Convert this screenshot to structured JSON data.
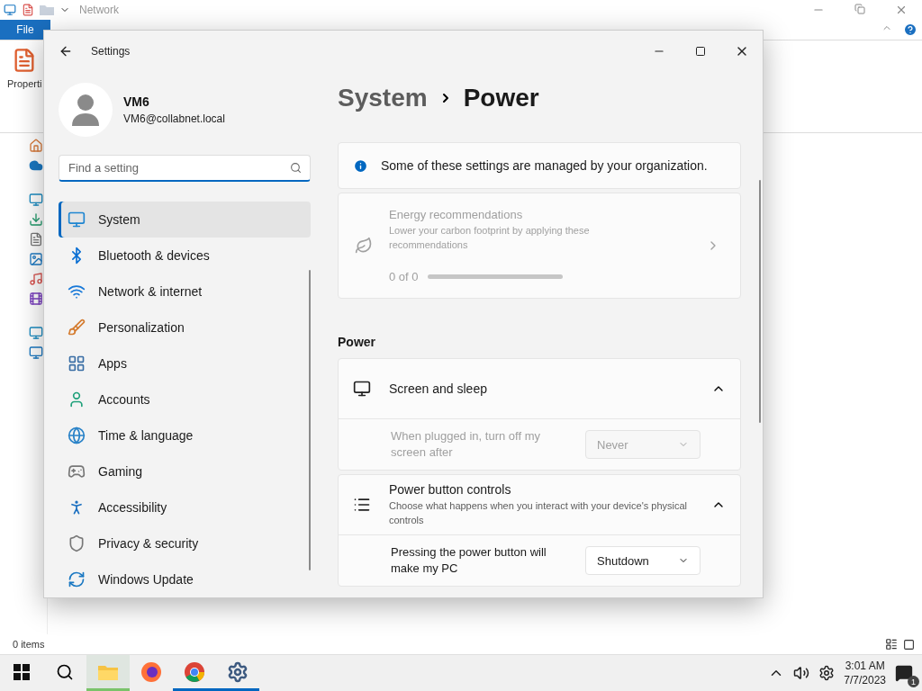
{
  "explorer": {
    "title": "Network",
    "ribbon_tabs": [
      {
        "label": "File",
        "selected": true
      }
    ],
    "ribbon_button": "Properti",
    "status": "0 items"
  },
  "settings": {
    "title": "Settings",
    "user": {
      "name": "VM6",
      "email": "VM6@collabnet.local"
    },
    "search": {
      "placeholder": "Find a setting",
      "focused": true
    },
    "nav": [
      {
        "label": "System",
        "selected": true
      },
      {
        "label": "Bluetooth & devices",
        "selected": false
      },
      {
        "label": "Network & internet",
        "selected": false
      },
      {
        "label": "Personalization",
        "selected": false
      },
      {
        "label": "Apps",
        "selected": false
      },
      {
        "label": "Accounts",
        "selected": false
      },
      {
        "label": "Time & language",
        "selected": false
      },
      {
        "label": "Gaming",
        "selected": false
      },
      {
        "label": "Accessibility",
        "selected": false
      },
      {
        "label": "Privacy & security",
        "selected": false
      },
      {
        "label": "Windows Update",
        "selected": false
      }
    ],
    "breadcrumb": [
      "System",
      "Power"
    ],
    "notice": "Some of these settings are managed by your organization.",
    "energy": {
      "title": "Energy recommendations",
      "description": "Lower your carbon footprint by applying these recommendations",
      "progress_text": "0 of 0",
      "level": 0,
      "disabled": true
    },
    "section": "Power",
    "groups": [
      {
        "title": "Screen and sleep",
        "expanded": true,
        "rows": [
          {
            "label": "When plugged in, turn off my screen after",
            "value": "Never",
            "disabled": true
          }
        ]
      },
      {
        "title": "Power button controls",
        "description": "Choose what happens when you interact with your device's physical controls",
        "expanded": true,
        "rows": [
          {
            "label": "Pressing the power button will make my PC",
            "value": "Shutdown",
            "disabled": false
          }
        ]
      }
    ]
  },
  "taskbar": {
    "apps": [
      {
        "kind": "explorer",
        "selected": true,
        "running": true
      },
      {
        "kind": "firefox",
        "selected": false,
        "running": false
      },
      {
        "kind": "chrome",
        "selected": false,
        "running": true
      },
      {
        "kind": "settings",
        "selected": false,
        "running": true
      }
    ],
    "time": "3:01 AM",
    "date": "7/7/2023",
    "notifications": "1"
  }
}
